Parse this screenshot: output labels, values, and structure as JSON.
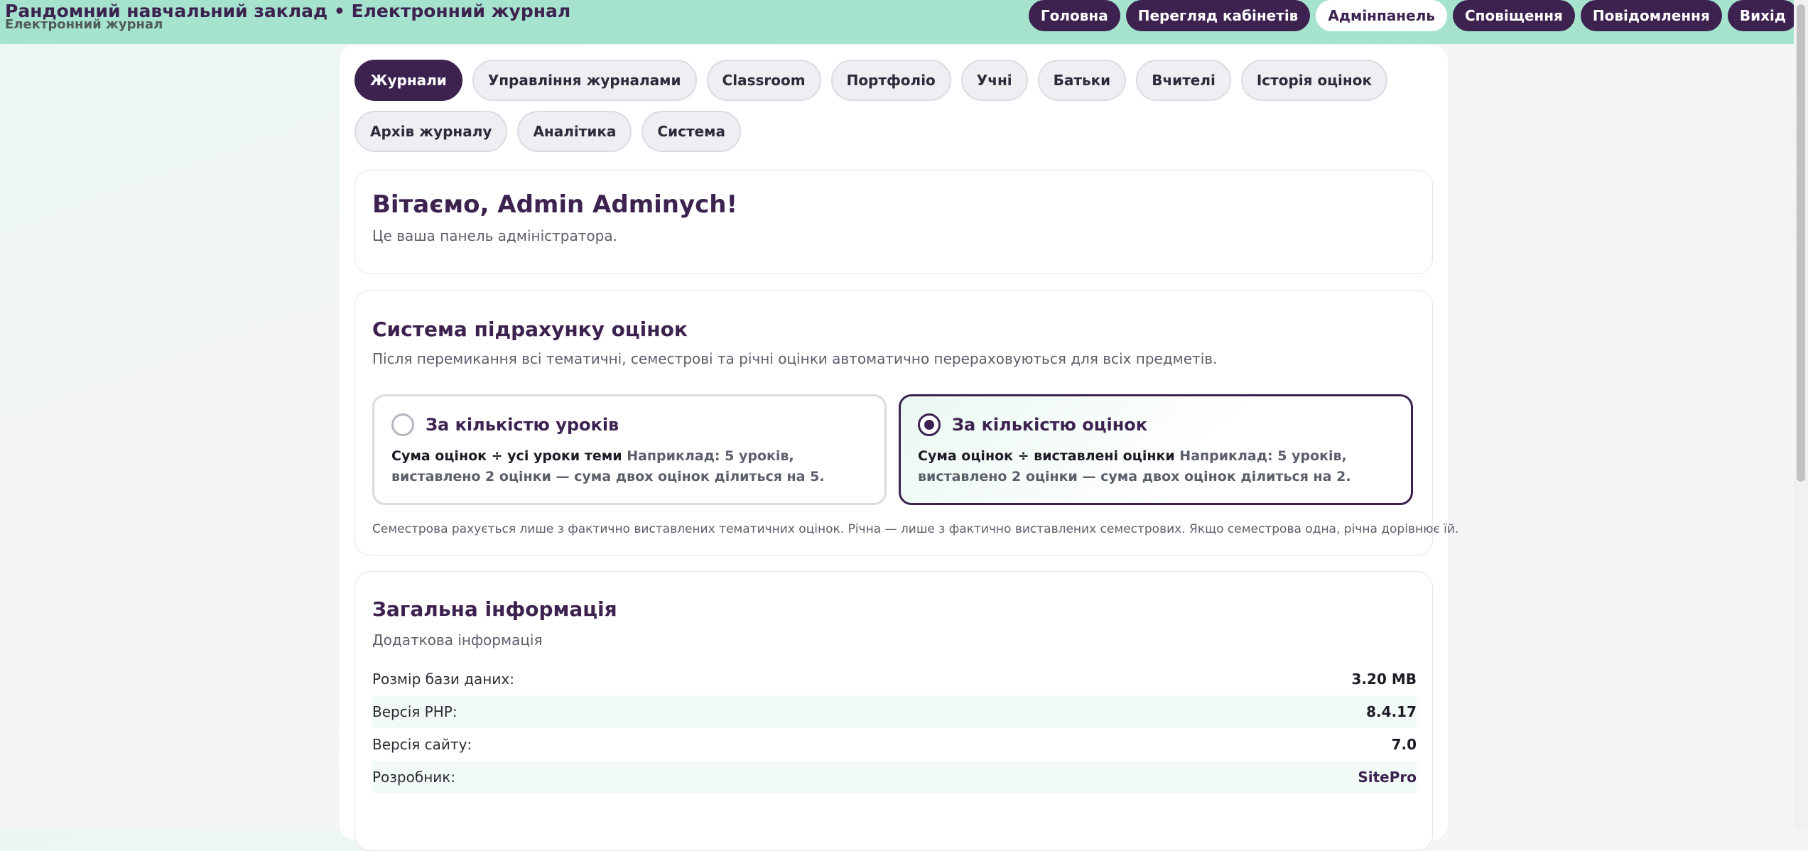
{
  "header": {
    "title": "Рандомний навчальний заклад • Електронний журнал",
    "subtitle": "Електронний журнал",
    "nav": [
      {
        "label": "Головна",
        "active": false
      },
      {
        "label": "Перегляд кабінетів",
        "active": false
      },
      {
        "label": "Адмінпанель",
        "active": true
      },
      {
        "label": "Сповіщення",
        "active": false
      },
      {
        "label": "Повідомлення",
        "active": false
      },
      {
        "label": "Вихід",
        "active": false
      }
    ]
  },
  "tabs": [
    {
      "label": "Журнали",
      "active": true
    },
    {
      "label": "Управління журналами",
      "active": false
    },
    {
      "label": "Classroom",
      "active": false
    },
    {
      "label": "Портфоліо",
      "active": false
    },
    {
      "label": "Учні",
      "active": false
    },
    {
      "label": "Батьки",
      "active": false
    },
    {
      "label": "Вчителі",
      "active": false
    },
    {
      "label": "Історія оцінок",
      "active": false
    },
    {
      "label": "Архів журналу",
      "active": false
    },
    {
      "label": "Аналітика",
      "active": false
    },
    {
      "label": "Система",
      "active": false
    }
  ],
  "welcome": {
    "title": "Вітаємо, Admin Adminych!",
    "text": "Це ваша панель адміністратора."
  },
  "grading": {
    "title": "Система підрахунку оцінок",
    "description": "Після перемикання всі тематичні, семестрові та річні оцінки автоматично перераховуються для всіх предметів.",
    "options": [
      {
        "title": "За кількістю уроків",
        "formula": "Сума оцінок ÷ усі уроки теми",
        "example": "Наприклад: 5 уроків, виставлено 2 оцінки — сума двох оцінок ділиться на 5.",
        "selected": false
      },
      {
        "title": "За кількістю оцінок",
        "formula": "Сума оцінок ÷ виставлені оцінки",
        "example": "Наприклад: 5 уроків, виставлено 2 оцінки — сума двох оцінок ділиться на 2.",
        "selected": true
      }
    ],
    "note": "Семестрова рахується лише з фактично виставлених тематичних оцінок. Річна — лише з фактично виставлених семестрових. Якщо семестрова одна, річна дорівнює їй."
  },
  "info": {
    "title": "Загальна інформація",
    "subtitle": "Додаткова інформація",
    "rows": [
      {
        "label": "Розмір бази даних:",
        "value": "3.20 MB"
      },
      {
        "label": "Версія PHP:",
        "value": "8.4.17"
      },
      {
        "label": "Версія сайту:",
        "value": "7.0"
      },
      {
        "label": "Розробник:",
        "value": "SitePro"
      }
    ]
  }
}
